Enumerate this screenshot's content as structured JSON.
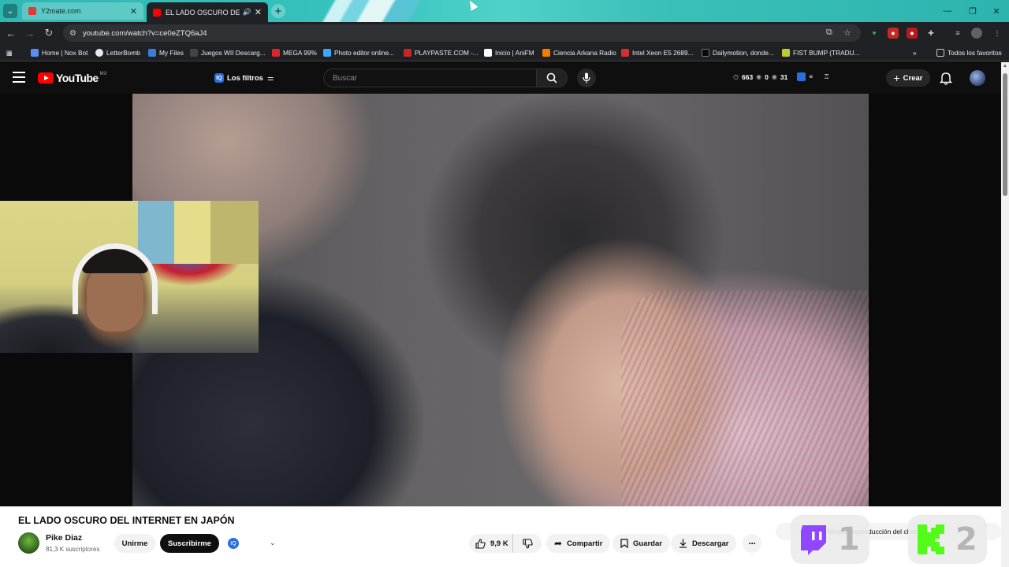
{
  "browser": {
    "tabs": [
      {
        "title": "Y2mate.com",
        "favicon_color": "#e53935",
        "active": false
      },
      {
        "title": "EL LADO OSCURO DEL INTE",
        "favicon_color": "#ff0000",
        "active": true
      }
    ],
    "url": "youtube.com/watch?v=ce0eZTQ6aJ4",
    "bookmarks": [
      {
        "label": "Home | Nox Bot",
        "color": "#5a8dee"
      },
      {
        "label": "LetterBomb",
        "color": "#e8eaed"
      },
      {
        "label": "My Files",
        "color": "#3b7dd8"
      },
      {
        "label": "Juegos WII Descarg...",
        "color": "#333333"
      },
      {
        "label": "MEGA 99%",
        "color": "#d9272e"
      },
      {
        "label": "Photo editor online...",
        "color": "#3ea6ff"
      },
      {
        "label": "PLAYPASTE.COM -...",
        "color": "#c62828"
      },
      {
        "label": "Inicio | AniFM",
        "color": "#ffffff"
      },
      {
        "label": "Ciencia Arkana Radio",
        "color": "#f57c00"
      },
      {
        "label": "Intel Xeon E5 2689...",
        "color": "#d32f2f"
      },
      {
        "label": "Dailymotion, donde...",
        "color": "#0a0a0a"
      },
      {
        "label": "FIST BUMP (TRADU...",
        "color": "#c0ca33"
      }
    ],
    "all_bookmarks": "Todos los favoritos"
  },
  "youtube": {
    "logo": "YouTube",
    "country": "MX",
    "filters_label": "Los filtros",
    "search_placeholder": "Buscar",
    "stats": {
      "a": "663",
      "b": "0",
      "c": "31"
    },
    "create_label": "Crear"
  },
  "video": {
    "title": "EL LADO OSCURO DEL INTERNET EN JAPÓN",
    "channel": "Pike Diaz",
    "subscribers": "81,3 K suscriptores",
    "join_label": "Unirme",
    "subscribe_label": "Suscribirme",
    "likes": "9,9 K",
    "share_label": "Compartir",
    "save_label": "Guardar",
    "download_label": "Descargar",
    "chat_text": "Mostrar reproducción del chat"
  },
  "overlays": {
    "twitch_count": "1",
    "kick_count": "2"
  }
}
